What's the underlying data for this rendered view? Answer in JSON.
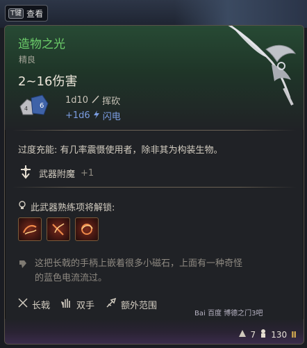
{
  "hotkey": {
    "key": "T键",
    "label": "查看"
  },
  "item": {
    "name": "造物之光",
    "rarity": "精良",
    "damage_range": "2~16伤害",
    "damage_base": "1d10",
    "damage_base_type": "挥砍",
    "damage_bonus": "+1d6",
    "damage_bonus_type": "闪电"
  },
  "enchant": {
    "description": "过度充能: 有几率震慑使用者，除非其为构装生物。",
    "label": "武器附魔",
    "value": "+1"
  },
  "proficiency": {
    "title": "此武器熟练项将解锁:",
    "skills": [
      "skill-1",
      "skill-2",
      "skill-3"
    ]
  },
  "flavor": {
    "line1": "这把长戟的手柄上嵌着很多小磁石，上面有一种奇怪",
    "line2": "的蓝色电流流过。"
  },
  "properties": [
    {
      "icon": "halberd-icon",
      "label": "长戟"
    },
    {
      "icon": "two-handed-icon",
      "label": "双手"
    },
    {
      "icon": "reach-icon",
      "label": "额外范围"
    }
  ],
  "footer": {
    "weight": "7",
    "value": "130"
  },
  "watermark": "Bai 百度 博德之门3吧",
  "colors": {
    "name": "#6ccd6a",
    "lightning": "#7b9de2",
    "accent_gold": "#d2a94f"
  }
}
